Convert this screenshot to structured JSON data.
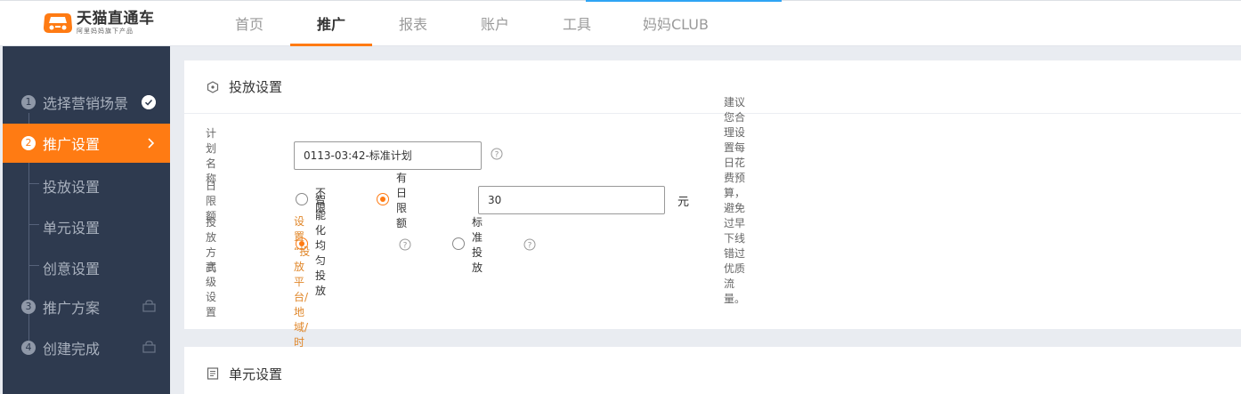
{
  "brand": {
    "title": "天猫直通车",
    "subtitle": "阿里妈妈旗下产品"
  },
  "nav": [
    {
      "label": "首页",
      "active": false
    },
    {
      "label": "推广",
      "active": true
    },
    {
      "label": "报表",
      "active": false
    },
    {
      "label": "账户",
      "active": false
    },
    {
      "label": "工具",
      "active": false
    },
    {
      "label": "妈妈CLUB",
      "active": false
    }
  ],
  "sidebar": {
    "steps": [
      {
        "num": "1",
        "label": "选择营销场景",
        "state": "done"
      },
      {
        "num": "2",
        "label": "推广设置",
        "state": "active"
      },
      {
        "num": "3",
        "label": "推广方案",
        "state": "locked"
      },
      {
        "num": "4",
        "label": "创建完成",
        "state": "locked"
      }
    ],
    "substeps": [
      "投放设置",
      "单元设置",
      "创意设置"
    ]
  },
  "delivery": {
    "title": "投放设置",
    "plan_name": {
      "label": "计划名称",
      "value": "0113-03:42-标准计划"
    },
    "daily_limit": {
      "label": "日限额",
      "options": [
        "不限",
        "有日限额"
      ],
      "selected": "有日限额",
      "value": "30",
      "unit": "元",
      "hint": "建议您合理设置每日花费预算，避免过早下线错过优质流量。"
    },
    "method": {
      "label": "投放方式",
      "options": [
        "智能化均匀投放",
        "标准投放"
      ],
      "selected": "智能化均匀投放"
    },
    "advanced": {
      "label": "高级设置",
      "link": "设置 “投放平台/地域/时间”"
    }
  },
  "unit_settings": {
    "title": "单元设置"
  },
  "colors": {
    "accent": "#ff7b13",
    "sidebar_bg": "#2e3a4f",
    "link": "#e0872a"
  }
}
